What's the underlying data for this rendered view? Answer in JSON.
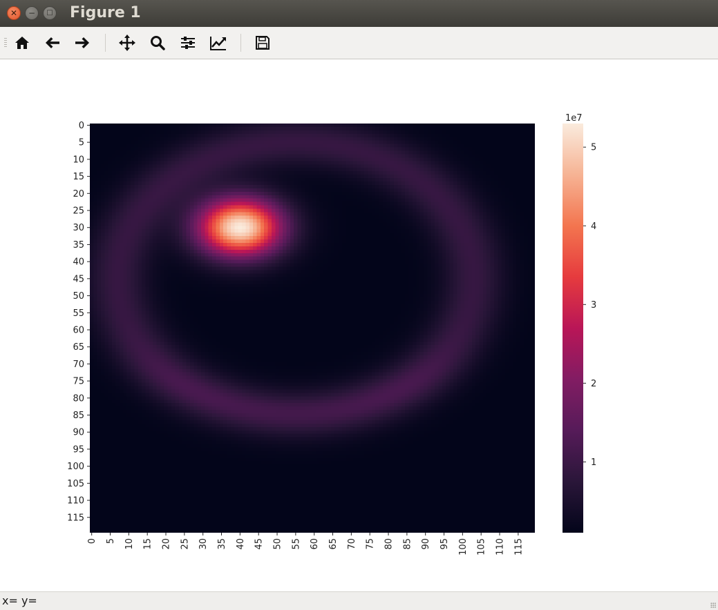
{
  "window": {
    "title": "Figure 1",
    "close_icon": "close-icon",
    "minimize_icon": "minimize-icon",
    "maximize_icon": "maximize-icon"
  },
  "toolbar": {
    "items": [
      {
        "name": "home",
        "icon": "home-icon"
      },
      {
        "name": "back",
        "icon": "arrow-left-icon"
      },
      {
        "name": "forward",
        "icon": "arrow-right-icon"
      },
      {
        "name": "pan",
        "icon": "move-icon"
      },
      {
        "name": "zoom",
        "icon": "magnifier-icon"
      },
      {
        "name": "configure-subplots",
        "icon": "sliders-icon"
      },
      {
        "name": "edit-axis",
        "icon": "line-chart-icon"
      },
      {
        "name": "save",
        "icon": "floppy-disk-icon"
      }
    ]
  },
  "status": {
    "text": "x= y="
  },
  "chart_data": {
    "type": "heatmap",
    "title": "",
    "xlabel": "",
    "ylabel": "",
    "grid_size": [
      120,
      120
    ],
    "x_ticks": [
      "0",
      "5",
      "10",
      "15",
      "20",
      "25",
      "30",
      "35",
      "40",
      "45",
      "50",
      "55",
      "60",
      "65",
      "70",
      "75",
      "80",
      "85",
      "90",
      "95",
      "100",
      "105",
      "110",
      "115"
    ],
    "y_ticks": [
      "0",
      "5",
      "10",
      "15",
      "20",
      "25",
      "30",
      "35",
      "40",
      "45",
      "50",
      "55",
      "60",
      "65",
      "70",
      "75",
      "80",
      "85",
      "90",
      "95",
      "100",
      "105",
      "110",
      "115"
    ],
    "colorbar": {
      "offset_label": "1e7",
      "ticks": [
        "1",
        "2",
        "3",
        "4",
        "5"
      ],
      "tick_values": [
        1,
        2,
        3,
        4,
        5
      ],
      "range": [
        0.1,
        5.3
      ],
      "colormap": "rocket"
    },
    "peak": {
      "row": 30,
      "col": 40,
      "value": 5.3
    },
    "features": [
      {
        "kind": "gaussian_peak",
        "row": 30,
        "col": 40,
        "sigma_row": 6,
        "sigma_col": 8,
        "amplitude": 5.2
      },
      {
        "kind": "ring",
        "center_row": 45,
        "center_col": 55,
        "radius_row": 40,
        "radius_col": 48,
        "amplitude": 1.1
      },
      {
        "kind": "background",
        "value": 0.1
      }
    ]
  }
}
